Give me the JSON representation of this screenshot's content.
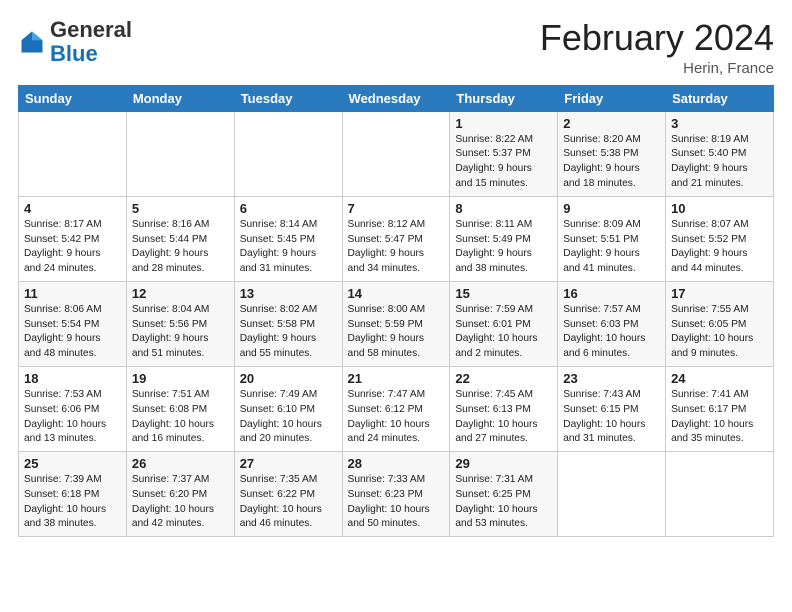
{
  "header": {
    "logo_general": "General",
    "logo_blue": "Blue",
    "title": "February 2024",
    "subtitle": "Herin, France"
  },
  "weekdays": [
    "Sunday",
    "Monday",
    "Tuesday",
    "Wednesday",
    "Thursday",
    "Friday",
    "Saturday"
  ],
  "rows": [
    [
      {
        "day": "",
        "info": ""
      },
      {
        "day": "",
        "info": ""
      },
      {
        "day": "",
        "info": ""
      },
      {
        "day": "",
        "info": ""
      },
      {
        "day": "1",
        "info": "Sunrise: 8:22 AM\nSunset: 5:37 PM\nDaylight: 9 hours\nand 15 minutes."
      },
      {
        "day": "2",
        "info": "Sunrise: 8:20 AM\nSunset: 5:38 PM\nDaylight: 9 hours\nand 18 minutes."
      },
      {
        "day": "3",
        "info": "Sunrise: 8:19 AM\nSunset: 5:40 PM\nDaylight: 9 hours\nand 21 minutes."
      }
    ],
    [
      {
        "day": "4",
        "info": "Sunrise: 8:17 AM\nSunset: 5:42 PM\nDaylight: 9 hours\nand 24 minutes."
      },
      {
        "day": "5",
        "info": "Sunrise: 8:16 AM\nSunset: 5:44 PM\nDaylight: 9 hours\nand 28 minutes."
      },
      {
        "day": "6",
        "info": "Sunrise: 8:14 AM\nSunset: 5:45 PM\nDaylight: 9 hours\nand 31 minutes."
      },
      {
        "day": "7",
        "info": "Sunrise: 8:12 AM\nSunset: 5:47 PM\nDaylight: 9 hours\nand 34 minutes."
      },
      {
        "day": "8",
        "info": "Sunrise: 8:11 AM\nSunset: 5:49 PM\nDaylight: 9 hours\nand 38 minutes."
      },
      {
        "day": "9",
        "info": "Sunrise: 8:09 AM\nSunset: 5:51 PM\nDaylight: 9 hours\nand 41 minutes."
      },
      {
        "day": "10",
        "info": "Sunrise: 8:07 AM\nSunset: 5:52 PM\nDaylight: 9 hours\nand 44 minutes."
      }
    ],
    [
      {
        "day": "11",
        "info": "Sunrise: 8:06 AM\nSunset: 5:54 PM\nDaylight: 9 hours\nand 48 minutes."
      },
      {
        "day": "12",
        "info": "Sunrise: 8:04 AM\nSunset: 5:56 PM\nDaylight: 9 hours\nand 51 minutes."
      },
      {
        "day": "13",
        "info": "Sunrise: 8:02 AM\nSunset: 5:58 PM\nDaylight: 9 hours\nand 55 minutes."
      },
      {
        "day": "14",
        "info": "Sunrise: 8:00 AM\nSunset: 5:59 PM\nDaylight: 9 hours\nand 58 minutes."
      },
      {
        "day": "15",
        "info": "Sunrise: 7:59 AM\nSunset: 6:01 PM\nDaylight: 10 hours\nand 2 minutes."
      },
      {
        "day": "16",
        "info": "Sunrise: 7:57 AM\nSunset: 6:03 PM\nDaylight: 10 hours\nand 6 minutes."
      },
      {
        "day": "17",
        "info": "Sunrise: 7:55 AM\nSunset: 6:05 PM\nDaylight: 10 hours\nand 9 minutes."
      }
    ],
    [
      {
        "day": "18",
        "info": "Sunrise: 7:53 AM\nSunset: 6:06 PM\nDaylight: 10 hours\nand 13 minutes."
      },
      {
        "day": "19",
        "info": "Sunrise: 7:51 AM\nSunset: 6:08 PM\nDaylight: 10 hours\nand 16 minutes."
      },
      {
        "day": "20",
        "info": "Sunrise: 7:49 AM\nSunset: 6:10 PM\nDaylight: 10 hours\nand 20 minutes."
      },
      {
        "day": "21",
        "info": "Sunrise: 7:47 AM\nSunset: 6:12 PM\nDaylight: 10 hours\nand 24 minutes."
      },
      {
        "day": "22",
        "info": "Sunrise: 7:45 AM\nSunset: 6:13 PM\nDaylight: 10 hours\nand 27 minutes."
      },
      {
        "day": "23",
        "info": "Sunrise: 7:43 AM\nSunset: 6:15 PM\nDaylight: 10 hours\nand 31 minutes."
      },
      {
        "day": "24",
        "info": "Sunrise: 7:41 AM\nSunset: 6:17 PM\nDaylight: 10 hours\nand 35 minutes."
      }
    ],
    [
      {
        "day": "25",
        "info": "Sunrise: 7:39 AM\nSunset: 6:18 PM\nDaylight: 10 hours\nand 38 minutes."
      },
      {
        "day": "26",
        "info": "Sunrise: 7:37 AM\nSunset: 6:20 PM\nDaylight: 10 hours\nand 42 minutes."
      },
      {
        "day": "27",
        "info": "Sunrise: 7:35 AM\nSunset: 6:22 PM\nDaylight: 10 hours\nand 46 minutes."
      },
      {
        "day": "28",
        "info": "Sunrise: 7:33 AM\nSunset: 6:23 PM\nDaylight: 10 hours\nand 50 minutes."
      },
      {
        "day": "29",
        "info": "Sunrise: 7:31 AM\nSunset: 6:25 PM\nDaylight: 10 hours\nand 53 minutes."
      },
      {
        "day": "",
        "info": ""
      },
      {
        "day": "",
        "info": ""
      }
    ]
  ]
}
